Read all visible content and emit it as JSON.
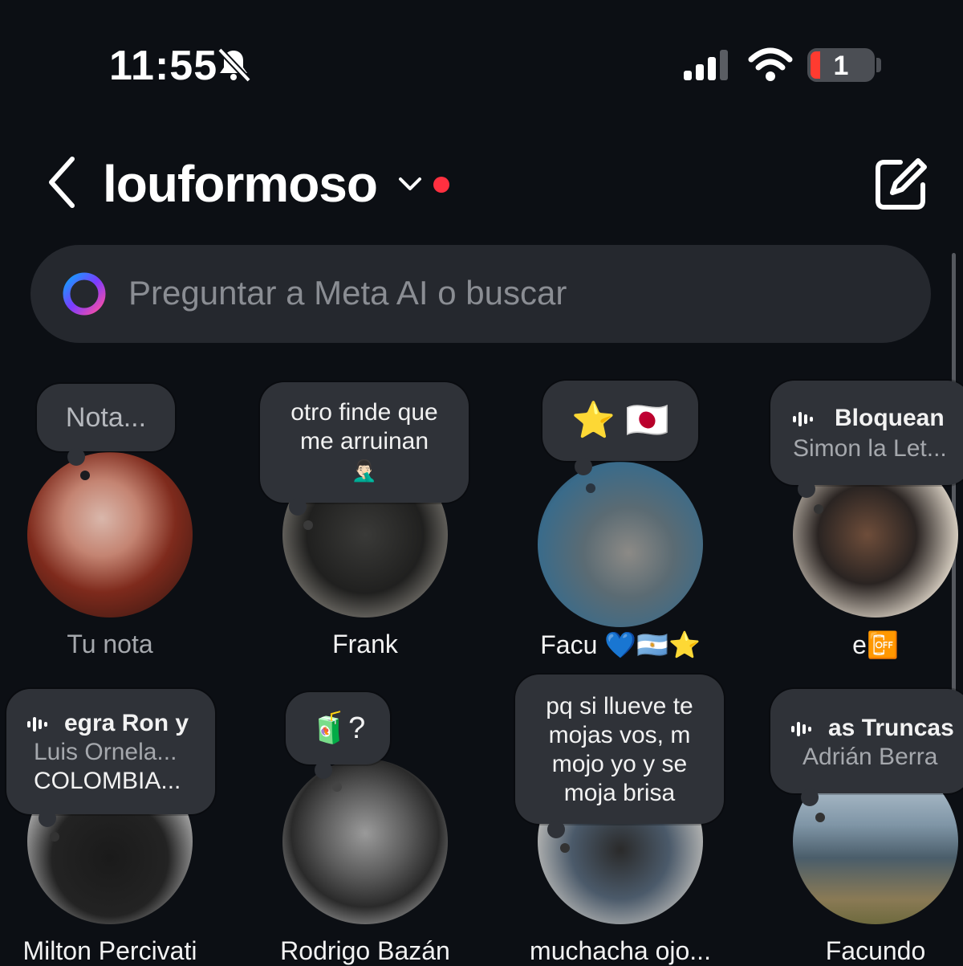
{
  "status_bar": {
    "time": "11:55",
    "battery": "1"
  },
  "header": {
    "username": "louformoso"
  },
  "search": {
    "placeholder": "Preguntar a Meta AI o buscar"
  },
  "notes": [
    {
      "name": "Tu nota",
      "note": "Nota..."
    },
    {
      "name": "Frank",
      "note_line1": "otro finde que",
      "note_line2": "me arruinan",
      "note_emoji": "🤦🏻‍♂️"
    },
    {
      "name": "Facu 💙🇦🇷⭐",
      "note": "⭐ 🇯🇵"
    },
    {
      "name": "e📴",
      "music_title": "Bloquean",
      "music_artist": "Simon la Let..."
    },
    {
      "name": "Milton Percivati",
      "music_title": "egra Ron y",
      "music_artist": "Luis Ornela...",
      "music_extra": "COLOMBIA..."
    },
    {
      "name": "Rodrigo Bazán",
      "note": "🧃?"
    },
    {
      "name": "muchacha ojo...",
      "note_lines": [
        "pq si llueve te",
        "mojas vos, m",
        "mojo yo y se",
        "moja brisa"
      ]
    },
    {
      "name": "Facundo",
      "music_title": "as Truncas",
      "music_artist": "Adrián Berra"
    }
  ],
  "colors": {
    "background": "#0c0f14",
    "bubble": "#2f3238",
    "search": "#25282e",
    "unread_dot": "#ff3040",
    "battery_low": "#ff3b30"
  },
  "icons": [
    "bell-slash-icon",
    "signal-icon",
    "wifi-icon",
    "battery-icon",
    "back-chevron-icon",
    "dropdown-chevron-icon",
    "compose-icon",
    "meta-ai-icon",
    "audio-bars-icon"
  ]
}
